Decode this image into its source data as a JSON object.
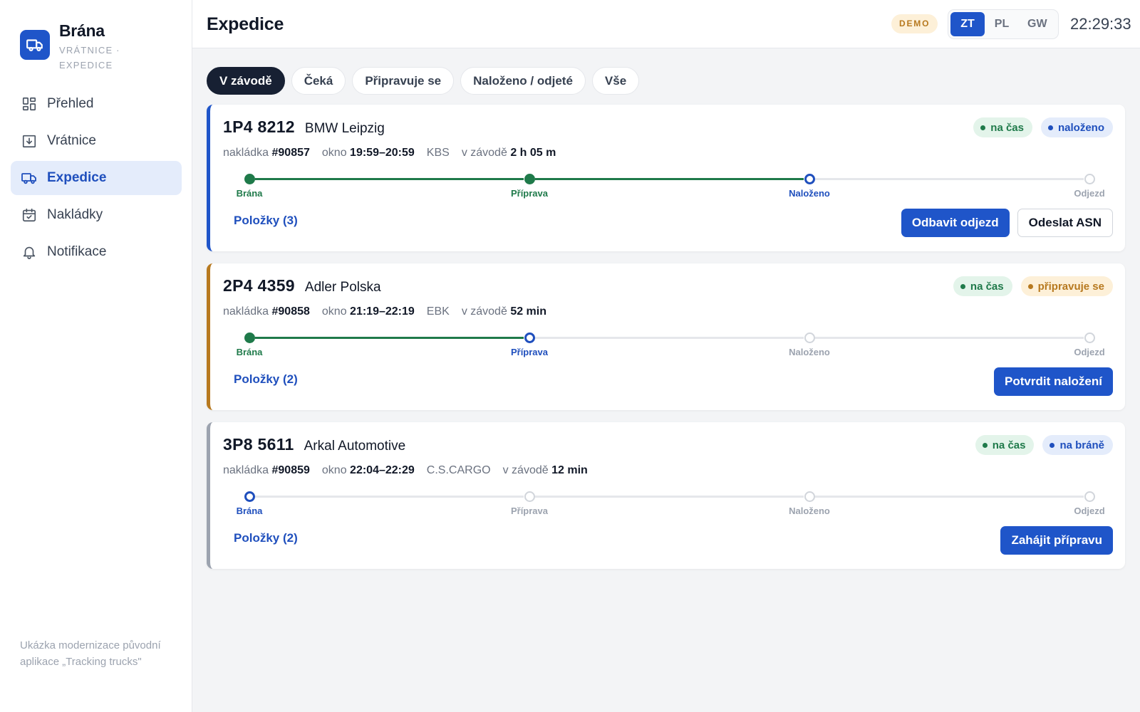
{
  "brand": {
    "title": "Brána",
    "subtitle": "VRÁTNICE · EXPEDICE",
    "icon": "truck-icon"
  },
  "nav": [
    {
      "label": "Přehled",
      "icon": "grid-icon",
      "active": false
    },
    {
      "label": "Vrátnice",
      "icon": "gate-icon",
      "active": false
    },
    {
      "label": "Expedice",
      "icon": "truck-icon",
      "active": true
    },
    {
      "label": "Nakládky",
      "icon": "calendar-check-icon",
      "active": false
    },
    {
      "label": "Notifikace",
      "icon": "bell-icon",
      "active": false
    }
  ],
  "footer_note": "Ukázka modernizace původní aplikace „Tracking trucks\"",
  "header": {
    "title": "Expedice",
    "demo_badge": "DEMO",
    "sites": [
      "ZT",
      "PL",
      "GW"
    ],
    "active_site": "ZT",
    "clock": "22:29:33"
  },
  "tabs": [
    {
      "label": "V závodě",
      "active": true
    },
    {
      "label": "Čeká",
      "active": false
    },
    {
      "label": "Připravuje se",
      "active": false
    },
    {
      "label": "Naloženo / odjeté",
      "active": false
    },
    {
      "label": "Vše",
      "active": false
    }
  ],
  "colors": {
    "accent": "#1f55c9",
    "green": "#1f7a4a",
    "amber": "#b7791f",
    "gray": "#9ca3af"
  },
  "trucks": [
    {
      "plate": "1P4 8212",
      "customer": "BMW Leipzig",
      "accent": "#1f55c9",
      "badges": [
        {
          "text": "na čas",
          "tone": "green"
        },
        {
          "text": "naloženo",
          "tone": "blue"
        }
      ],
      "meta": {
        "load_label": "nakládka",
        "load_no": "#90857",
        "window_label": "okno",
        "window": "19:59–20:59",
        "carrier": "KBS",
        "in_plant_label": "v závodě",
        "in_plant": "2 h 05 m"
      },
      "steps": [
        "Brána",
        "Příprava",
        "Naloženo",
        "Odjezd"
      ],
      "current_step": 2,
      "items_link": "Položky (3)",
      "actions": [
        {
          "label": "Odbavit odjezd",
          "style": "primary"
        },
        {
          "label": "Odeslat ASN",
          "style": "secondary"
        }
      ]
    },
    {
      "plate": "2P4 4359",
      "customer": "Adler Polska",
      "accent": "#b7791f",
      "badges": [
        {
          "text": "na čas",
          "tone": "green"
        },
        {
          "text": "připravuje se",
          "tone": "amber"
        }
      ],
      "meta": {
        "load_label": "nakládka",
        "load_no": "#90858",
        "window_label": "okno",
        "window": "21:19–22:19",
        "carrier": "EBK",
        "in_plant_label": "v závodě",
        "in_plant": "52 min"
      },
      "steps": [
        "Brána",
        "Příprava",
        "Naloženo",
        "Odjezd"
      ],
      "current_step": 1,
      "items_link": "Položky (2)",
      "actions": [
        {
          "label": "Potvrdit naložení",
          "style": "primary"
        }
      ]
    },
    {
      "plate": "3P8 5611",
      "customer": "Arkal Automotive",
      "accent": "#9ca3af",
      "badges": [
        {
          "text": "na čas",
          "tone": "green"
        },
        {
          "text": "na bráně",
          "tone": "blue"
        }
      ],
      "meta": {
        "load_label": "nakládka",
        "load_no": "#90859",
        "window_label": "okno",
        "window": "22:04–22:29",
        "carrier": "C.S.CARGO",
        "in_plant_label": "v závodě",
        "in_plant": "12 min"
      },
      "steps": [
        "Brána",
        "Příprava",
        "Naloženo",
        "Odjezd"
      ],
      "current_step": 0,
      "items_link": "Položky (2)",
      "actions": [
        {
          "label": "Zahájit přípravu",
          "style": "primary"
        }
      ]
    }
  ]
}
